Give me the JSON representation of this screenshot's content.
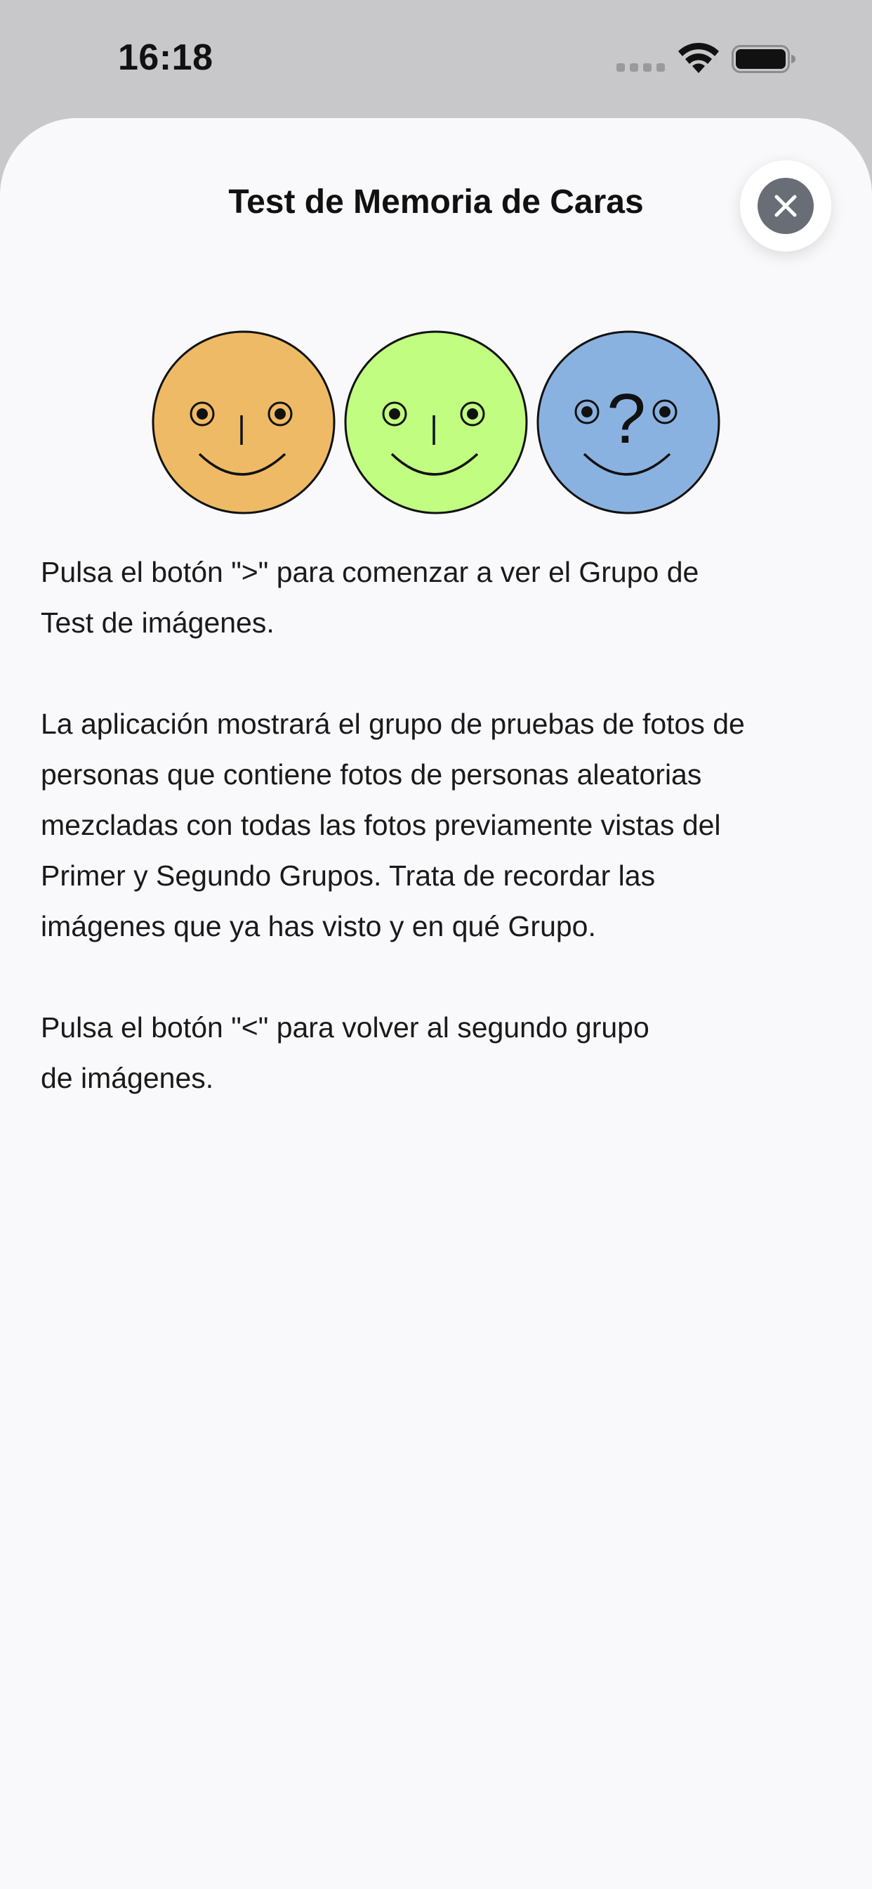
{
  "status_bar": {
    "time": "16:18",
    "signal_icon": "cellular-signal-icon",
    "wifi_icon": "wifi-icon",
    "battery_icon": "battery-icon"
  },
  "sheet": {
    "title": "Test de Memoria de Caras",
    "close_icon": "close-icon",
    "faces": [
      {
        "color": "#efba66",
        "label": ""
      },
      {
        "color": "#c0fd80",
        "label": ""
      },
      {
        "color": "#8ab2e0",
        "label": "?"
      }
    ],
    "paragraphs": [
      "Pulsa el botón \">\" para comenzar a ver el Grupo de\nTest de imágenes.",
      "La aplicación mostrará el grupo de pruebas de fotos de\npersonas que contiene fotos de personas aleatorias\nmezcladas con todas las fotos previamente vistas del\nPrimer y Segundo Grupos. Trata de recordar las\nimágenes que ya has visto y en qué Grupo.",
      "Pulsa el botón \"<\" para volver al segundo grupo\nde imágenes."
    ]
  }
}
